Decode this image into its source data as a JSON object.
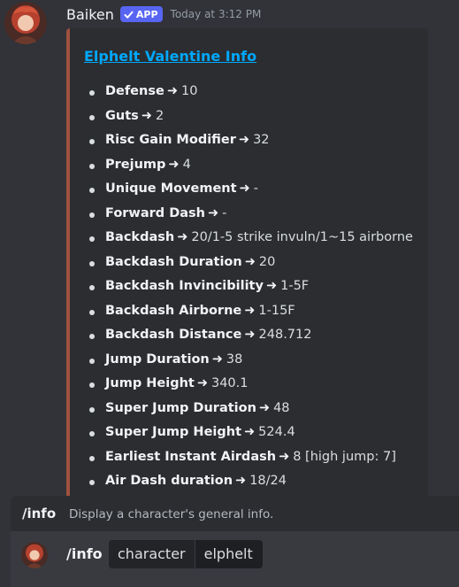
{
  "message": {
    "author": "Baiken",
    "badge": "APP",
    "timestamp": "Today at 3:12 PM"
  },
  "embed": {
    "accent_color": "#a0513e",
    "title": "Elphelt Valentine Info",
    "arrow": "➜",
    "fields": [
      {
        "name": "Defense",
        "value": "10"
      },
      {
        "name": "Guts",
        "value": "2"
      },
      {
        "name": "Risc Gain Modifier",
        "value": "32"
      },
      {
        "name": "Prejump",
        "value": "4"
      },
      {
        "name": "Unique Movement",
        "value": "-"
      },
      {
        "name": "Forward Dash",
        "value": "-"
      },
      {
        "name": "Backdash",
        "value": "20/1-5 strike invuln/1~15 airborne"
      },
      {
        "name": "Backdash Duration",
        "value": "20"
      },
      {
        "name": "Backdash Invincibility",
        "value": "1-5F"
      },
      {
        "name": "Backdash Airborne",
        "value": "1-15F"
      },
      {
        "name": "Backdash Distance",
        "value": "248.712"
      },
      {
        "name": "Jump Duration",
        "value": "38"
      },
      {
        "name": "Jump Height",
        "value": "340.1"
      },
      {
        "name": "Super Jump Duration",
        "value": "48"
      },
      {
        "name": "Super Jump Height",
        "value": "524.4"
      },
      {
        "name": "Earliest Instant Airdash",
        "value": "8 [high jump: 7]"
      },
      {
        "name": "Air Dash duration",
        "value": "18/24"
      }
    ]
  },
  "autocomplete": {
    "command": "/info",
    "description": "Display a character's general info."
  },
  "composer": {
    "command": "/info",
    "option_name": "character",
    "option_value": "elphelt"
  }
}
